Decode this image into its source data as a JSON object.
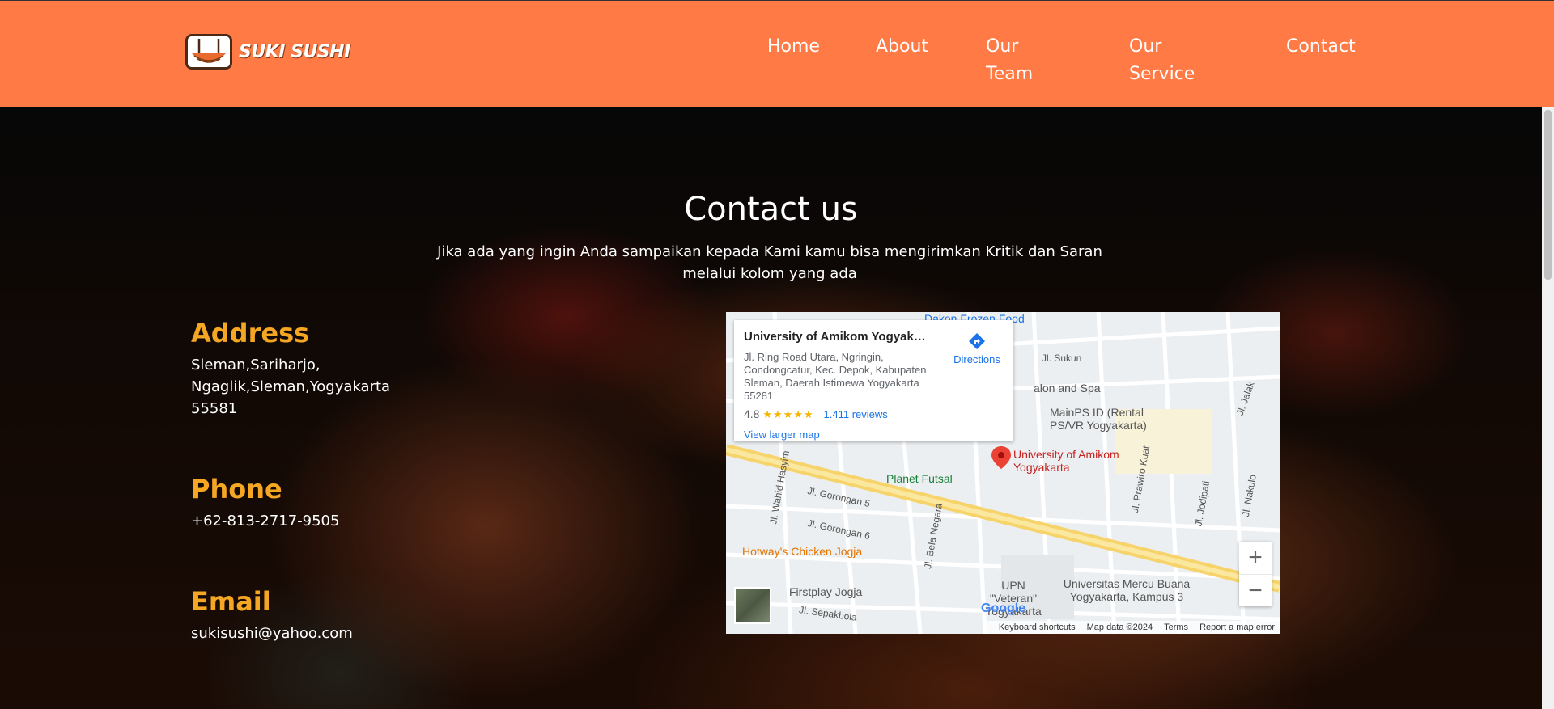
{
  "brand": {
    "name": "SUKI SUSHI"
  },
  "nav": {
    "items": [
      "Home",
      "About",
      "Our Team",
      "Our Service",
      "Contact"
    ]
  },
  "contact": {
    "title": "Contact us",
    "subtitle": "Jika ada yang ingin Anda sampaikan kepada Kami kamu bisa mengirimkan Kritik dan Saran melalui kolom yang ada",
    "address_label": "Address",
    "address_value": "Sleman,Sariharjo, Ngaglik,Sleman,Yogyakarta 55581",
    "phone_label": "Phone",
    "phone_value": "+62-813-2717-9505",
    "email_label": "Email",
    "email_value": "sukisushi@yahoo.com"
  },
  "map": {
    "place_name": "University of Amikom Yogyak…",
    "address": "Jl. Ring Road Utara, Ngringin, Condongcatur, Kec. Depok, Kabupaten Sleman, Daerah Istimewa Yogyakarta 55281",
    "rating": "4.8",
    "stars": "★★★★★",
    "reviews": "1.411 reviews",
    "view_larger": "View larger map",
    "directions": "Directions",
    "pin_label": "University of Amikom Yogyakarta",
    "places": {
      "dakon": "Dakon Frozen Food",
      "salon": "alon and Spa",
      "mainps": "MainPS ID (Rental PS/VR Yogyakarta)",
      "planet": "Planet Futsal",
      "hotway": "Hotway's Chicken Jogja",
      "firstplay": "Firstplay Jogja",
      "upn": "UPN \"Veteran\" Yogyakarta",
      "mercu": "Universitas Mercu Buana Yogyakarta, Kampus 3"
    },
    "roads": {
      "sukun": "Jl. Sukun",
      "jalak": "Jl. Jalak",
      "gorongan5": "Jl. Gorongan 5",
      "gorongan6": "Jl. Gorongan 6",
      "wahid": "Jl. Wahid Hasyim",
      "prawiro": "Jl. Prawiro Kuat",
      "jodipati": "Jl. Jodipati",
      "nakulo": "Jl. Nakulo",
      "belanegara": "Jl. Bela Negara",
      "sepakbola": "Jl. Sepakbola"
    },
    "zoom_in": "+",
    "zoom_out": "−",
    "google": "Google",
    "footer": {
      "shortcuts": "Keyboard shortcuts",
      "data": "Map data ©2024",
      "terms": "Terms",
      "report": "Report a map error"
    }
  },
  "colors": {
    "header": "#ff7a45",
    "accent": "#f5a623"
  }
}
